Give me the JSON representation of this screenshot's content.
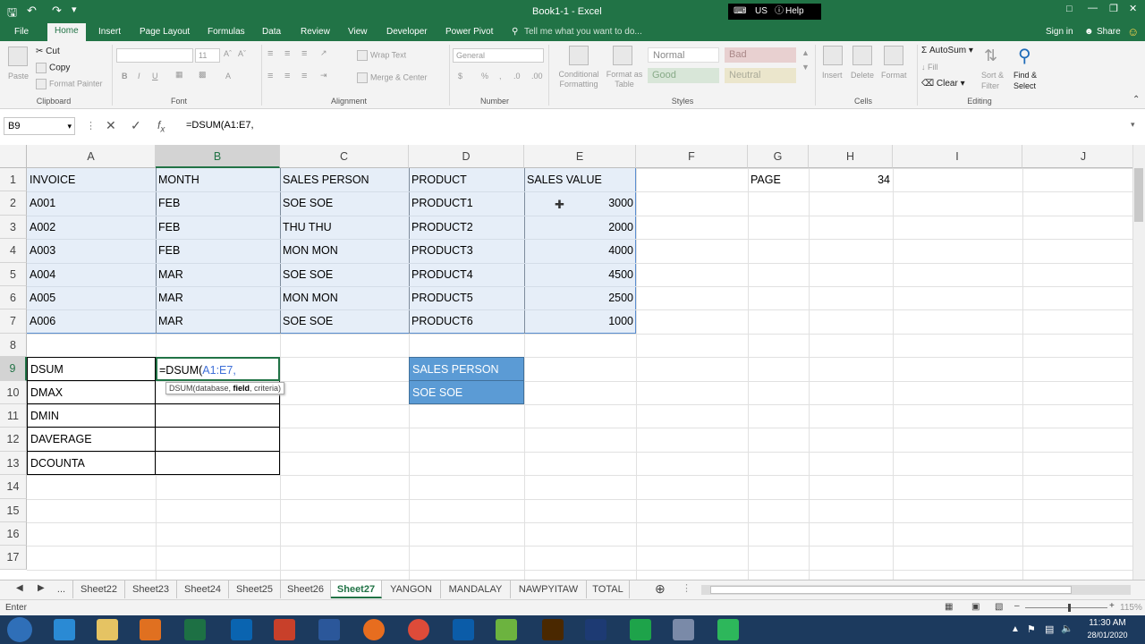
{
  "title": "Book1-1 - Excel",
  "lang": "US",
  "help": "Help",
  "ribbon_tabs": [
    "File",
    "Home",
    "Insert",
    "Page Layout",
    "Formulas",
    "Data",
    "Review",
    "View",
    "Developer",
    "Power Pivot"
  ],
  "tell_me": "Tell me what you want to do...",
  "sign_in": "Sign in",
  "share": "Share",
  "clipboard": {
    "paste": "Paste",
    "cut": "Cut",
    "copy": "Copy",
    "format_painter": "Format Painter",
    "label": "Clipboard"
  },
  "font": {
    "size": "11",
    "label": "Font"
  },
  "alignment": {
    "wrap": "Wrap Text",
    "merge": "Merge & Center",
    "label": "Alignment"
  },
  "number": {
    "format": "General",
    "label": "Number"
  },
  "styles": {
    "conditional": "Conditional Formatting",
    "format_table": "Format as Table",
    "normal": "Normal",
    "bad": "Bad",
    "good": "Good",
    "neutral": "Neutral",
    "label": "Styles"
  },
  "cells": {
    "insert": "Insert",
    "delete": "Delete",
    "format": "Format",
    "label": "Cells"
  },
  "editing": {
    "autosum": "AutoSum",
    "fill": "Fill",
    "clear": "Clear",
    "sort": "Sort & Filter",
    "find": "Find & Select",
    "label": "Editing"
  },
  "namebox": "B9",
  "formula": "=DSUM(A1:E7,",
  "columns": [
    "A",
    "B",
    "C",
    "D",
    "E",
    "F",
    "G",
    "H",
    "I",
    "J"
  ],
  "rows": [
    "1",
    "2",
    "3",
    "4",
    "5",
    "6",
    "7",
    "8",
    "9",
    "10",
    "11",
    "12",
    "13",
    "14",
    "15",
    "16",
    "17"
  ],
  "header": [
    "INVOICE",
    "MONTH",
    "SALES PERSON",
    "PRODUCT",
    "SALES VALUE"
  ],
  "data": [
    [
      "A001",
      "FEB",
      "SOE SOE",
      "PRODUCT1",
      "3000"
    ],
    [
      "A002",
      "FEB",
      "THU THU",
      "PRODUCT2",
      "2000"
    ],
    [
      "A003",
      "FEB",
      "MON MON",
      "PRODUCT3",
      "4000"
    ],
    [
      "A004",
      "MAR",
      "SOE SOE",
      "PRODUCT4",
      "4500"
    ],
    [
      "A005",
      "MAR",
      "MON MON",
      "PRODUCT5",
      "2500"
    ],
    [
      "A006",
      "MAR",
      "SOE SOE",
      "PRODUCT6",
      "1000"
    ]
  ],
  "page_label": "PAGE",
  "page_value": "34",
  "functions": [
    "DSUM",
    "DMAX",
    "DMIN",
    "DAVERAGE",
    "DCOUNTA"
  ],
  "edit_prefix": "=DSUM(",
  "edit_range": "A1:E7,",
  "tooltip": {
    "fn": "DSUM(database, ",
    "bold": "field",
    ", rest": ", criteria)"
  },
  "criteria": {
    "header": "SALES PERSON",
    "value": "SOE SOE"
  },
  "sheets": [
    "...",
    "Sheet22",
    "Sheet23",
    "Sheet24",
    "Sheet25",
    "Sheet26",
    "Sheet27",
    "YANGON",
    "MANDALAY",
    "NAWPYITAW",
    "TOTAL"
  ],
  "status": "Enter",
  "zoom": "115%",
  "clock": {
    "time": "11:30 AM",
    "date": "28/01/2020"
  }
}
